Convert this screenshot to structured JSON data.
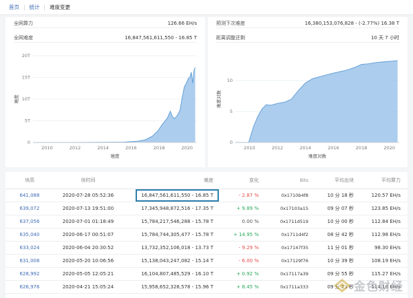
{
  "breadcrumb": {
    "home": "首页",
    "stats": "统计",
    "current": "难度变更"
  },
  "left_stats": [
    {
      "label": "全网算力",
      "value": "126.66 EH/s"
    },
    {
      "label": "全网难度",
      "value": "16,847,561,611,550 - 16.85 T"
    }
  ],
  "right_stats": [
    {
      "label": "预测下次难度",
      "value": "16,380,153,076,828 - (-2.77%) 16.38 T"
    },
    {
      "label": "距离调整还剩",
      "value": "10 天 7 小时"
    }
  ],
  "chart_data": [
    {
      "type": "area",
      "xlabel": "难度",
      "ylabel": "难度",
      "x_ticks": [
        "2010",
        "2012",
        "2014",
        "2016",
        "2018",
        "2020"
      ],
      "y_ticks": [
        "0",
        "5T",
        "10T",
        "15T",
        "20T"
      ],
      "xlim": [
        2009.0,
        2020.7
      ],
      "ylim": [
        0,
        20
      ],
      "color": "#9ec4ea",
      "line_color": "#5b9bd5",
      "x": [
        2009.0,
        2012.0,
        2014.0,
        2015.5,
        2016.5,
        2017.0,
        2017.5,
        2017.9,
        2018.2,
        2018.6,
        2018.8,
        2018.95,
        2019.1,
        2019.3,
        2019.5,
        2019.65,
        2019.8,
        2019.95,
        2020.1,
        2020.2,
        2020.3,
        2020.4,
        2020.5,
        2020.58
      ],
      "y": [
        0,
        0.0,
        0.05,
        0.1,
        0.3,
        0.6,
        1.4,
        2.6,
        4.0,
        5.7,
        7.2,
        6.0,
        5.5,
        6.2,
        7.5,
        10.3,
        12.8,
        13.7,
        14.8,
        15.0,
        16.2,
        13.7,
        16.7,
        17.3
      ]
    },
    {
      "type": "area",
      "xlabel": "难度对数",
      "ylabel": "难度对数",
      "x_ticks": [
        "2010",
        "2012",
        "2014",
        "2016",
        "2018",
        "2020"
      ],
      "y_ticks": [
        "0",
        "5",
        "10"
      ],
      "xlim": [
        2009.0,
        2020.7
      ],
      "ylim": [
        0,
        14
      ],
      "color": "#9ec4ea",
      "line_color": "#5b9bd5",
      "x": [
        2009.0,
        2009.95,
        2010.05,
        2010.3,
        2010.6,
        2010.9,
        2011.2,
        2011.5,
        2012.0,
        2012.5,
        2013.0,
        2013.5,
        2014.0,
        2014.5,
        2015.0,
        2016.0,
        2017.0,
        2017.5,
        2018.0,
        2018.5,
        2019.0,
        2019.5,
        2020.0,
        2020.58
      ],
      "y": [
        0,
        0,
        0.8,
        2.6,
        4.2,
        5.4,
        6.1,
        6.0,
        6.3,
        6.5,
        7.0,
        8.4,
        9.6,
        10.3,
        10.6,
        11.2,
        11.7,
        12.1,
        12.6,
        12.7,
        12.9,
        13.0,
        13.1,
        13.2
      ]
    }
  ],
  "table": {
    "headers": [
      "块高",
      "块时间",
      "难度",
      "变化",
      "Bits",
      "平均出块",
      "平均算力"
    ],
    "rows": [
      {
        "height": "641,088",
        "time": "2020-07-28 05:52:36",
        "difficulty": "16,847,561,611,550 - 16.85 T",
        "change": "- 2.87 %",
        "change_kind": "neg",
        "bits": "0x1710b4f8",
        "avg_block": "10 分 18 秒",
        "avg_hash": "120.57 EH/s",
        "highlight": true
      },
      {
        "height": "639,072",
        "time": "2020-07-13 19:51:00",
        "difficulty": "17,345,948,872,516 - 17.35 T",
        "change": "+ 9.89 %",
        "change_kind": "pos",
        "bits": "0x17103a15",
        "avg_block": "09 分 07 秒",
        "avg_hash": "123.85 EH/s"
      },
      {
        "height": "637,056",
        "time": "2020-07-01 01:18:49",
        "difficulty": "15,784,217,546,288 - 15.78 T",
        "change": "0.00 %",
        "change_kind": "neu",
        "bits": "0x1711d519",
        "avg_block": "10 分 00 秒",
        "avg_hash": "112.84 EH/s"
      },
      {
        "height": "635,040",
        "time": "2020-06-17 00:51:07",
        "difficulty": "15,784,744,305,477 - 15.78 T",
        "change": "+ 14.95 %",
        "change_kind": "pos",
        "bits": "0x1711d4f2",
        "avg_block": "08 分 42 秒",
        "avg_hash": "112.98 EH/s"
      },
      {
        "height": "633,024",
        "time": "2020-06-04 20:30:52",
        "difficulty": "13,732,352,106,018 - 13.73 T",
        "change": "- 9.29 %",
        "change_kind": "neg",
        "bits": "0x17147f35",
        "avg_block": "11 分 01 秒",
        "avg_hash": "98.30 EH/s"
      },
      {
        "height": "631,008",
        "time": "2020-05-20 10:06:56",
        "difficulty": "15,138,043,247,082 - 15.14 T",
        "change": "- 6.00 %",
        "change_kind": "neg",
        "bits": "0x17129f76",
        "avg_block": "10 分 39 秒",
        "avg_hash": "108.19 EH/s"
      },
      {
        "height": "628,992",
        "time": "2020-05-05 12:05:21",
        "difficulty": "16,104,807,485,529 - 16.10 T",
        "change": "+ 0.92 %",
        "change_kind": "pos",
        "bits": "0x17117a39",
        "avg_block": "09 分 55 秒",
        "avg_hash": "115.27 EH/s"
      },
      {
        "height": "626,976",
        "time": "2020-04-21 15:05:24",
        "difficulty": "15,958,652,328,578 - 15.96 T",
        "change": "+ 8.45 %",
        "change_kind": "pos",
        "bits": "0x1711a333",
        "avg_block": "09 分 13 秒",
        "avg_hash": "114.10 EH/s"
      }
    ]
  },
  "watermark": {
    "text": "金色财经",
    "logo_icon": "diamond-logo-icon"
  }
}
